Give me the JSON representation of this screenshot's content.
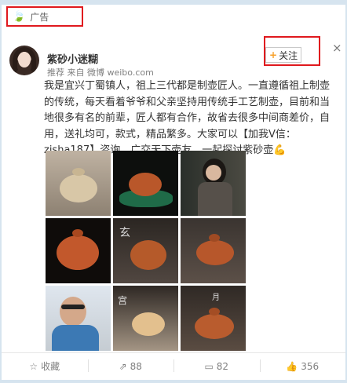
{
  "ad": {
    "label": "广告",
    "icon": "leaf-icon"
  },
  "user": {
    "name": "紫砂小迷糊",
    "meta": "推荐 来自 微博 weibo.com"
  },
  "follow": {
    "label": "关注"
  },
  "close": {
    "glyph": "×"
  },
  "post": {
    "text": "我是宜兴丁蜀镇人，祖上三代都是制壶匠人。一直遵循祖上制壶的传统，每天看着爷爷和父亲坚持用传统手工艺制壶，目前和当地很多有名的前辈，匠人都有合作，故省去很多中间商差价，自用，送礼均可，款式，精品繁多。大家可以【加我V信：zisha187】咨询，广交天下壶友，一起探讨紫砂壶💪"
  },
  "images": {
    "overlays": [
      "玄",
      "宫",
      "月"
    ]
  },
  "actions": {
    "favorite": "收藏",
    "repost": "88",
    "comment": "82",
    "like": "356"
  },
  "colors": {
    "highlight": "#e0191e",
    "accent": "#f7a02a",
    "page_bg": "#d6e4ef"
  }
}
